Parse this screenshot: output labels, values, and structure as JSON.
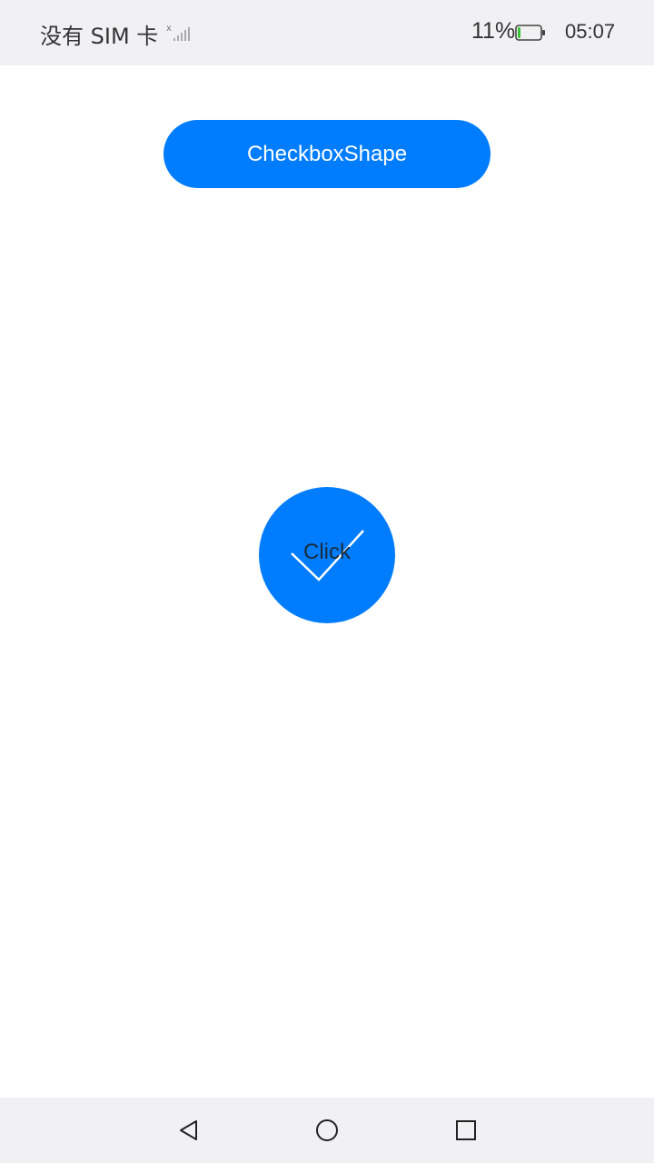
{
  "status_bar": {
    "carrier": "没有 SIM 卡",
    "battery_percent": "11%",
    "battery_level": 0.11,
    "time": "05:07"
  },
  "main": {
    "title_button_label": "CheckboxShape",
    "checkbox_label": "Click",
    "checkbox_checked": true,
    "accent_color": "#007dff"
  },
  "nav_bar": {
    "icons": [
      "back-icon",
      "home-icon",
      "recents-icon"
    ]
  }
}
